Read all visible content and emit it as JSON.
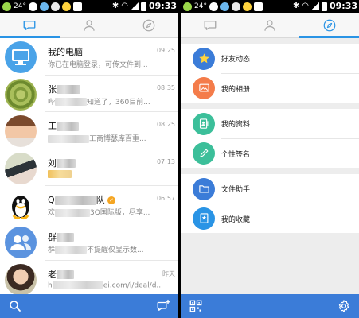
{
  "status_bar": {
    "temperature": "24°",
    "time": "09:33"
  },
  "conversations": [
    {
      "name": "我的电脑",
      "time": "09:25",
      "message": "你已在电脑登录，可传文件到...",
      "name_hidden": false
    },
    {
      "name": "张",
      "time": "08:35",
      "message_prefix": "哔",
      "message": "知道了，360目前...",
      "name_hidden": true
    },
    {
      "name": "工",
      "time": "08:25",
      "message_prefix": "",
      "message": "工商博瑟库百重...",
      "name_hidden": true
    },
    {
      "name": "刘",
      "time": "07:13",
      "message_prefix": "",
      "message": "",
      "name_hidden": true
    },
    {
      "name": "Q",
      "name_suffix": "队",
      "time": "06:57",
      "message_prefix": "欢",
      "message": "3Q国际版，尽享...",
      "name_hidden": true
    },
    {
      "name": "群",
      "time": "",
      "message_prefix": "群",
      "message": "不提醒仅显示数...",
      "name_hidden": true
    },
    {
      "name": "老",
      "time": "昨天",
      "message_prefix": "h",
      "message": "ei.com/i/deal/d...",
      "name_hidden": true
    }
  ],
  "right_menu": {
    "groups": [
      [
        {
          "label": "好友动态",
          "icon": "star-icon",
          "color": "#3b7cd8"
        },
        {
          "label": "我的相册",
          "icon": "photo-icon",
          "color": "#f47c4a"
        }
      ],
      [
        {
          "label": "我的资料",
          "icon": "profile-icon",
          "color": "#3cbf9a"
        },
        {
          "label": "个性签名",
          "icon": "pencil-icon",
          "color": "#3cbf9a"
        }
      ],
      [
        {
          "label": "文件助手",
          "icon": "folder-icon",
          "color": "#3b7cd8"
        },
        {
          "label": "我的收藏",
          "icon": "bookmark-icon",
          "color": "#2a94e5"
        }
      ]
    ]
  },
  "colors": {
    "accent": "#2a94e5",
    "bottom_bar": "#3b7cd8"
  }
}
